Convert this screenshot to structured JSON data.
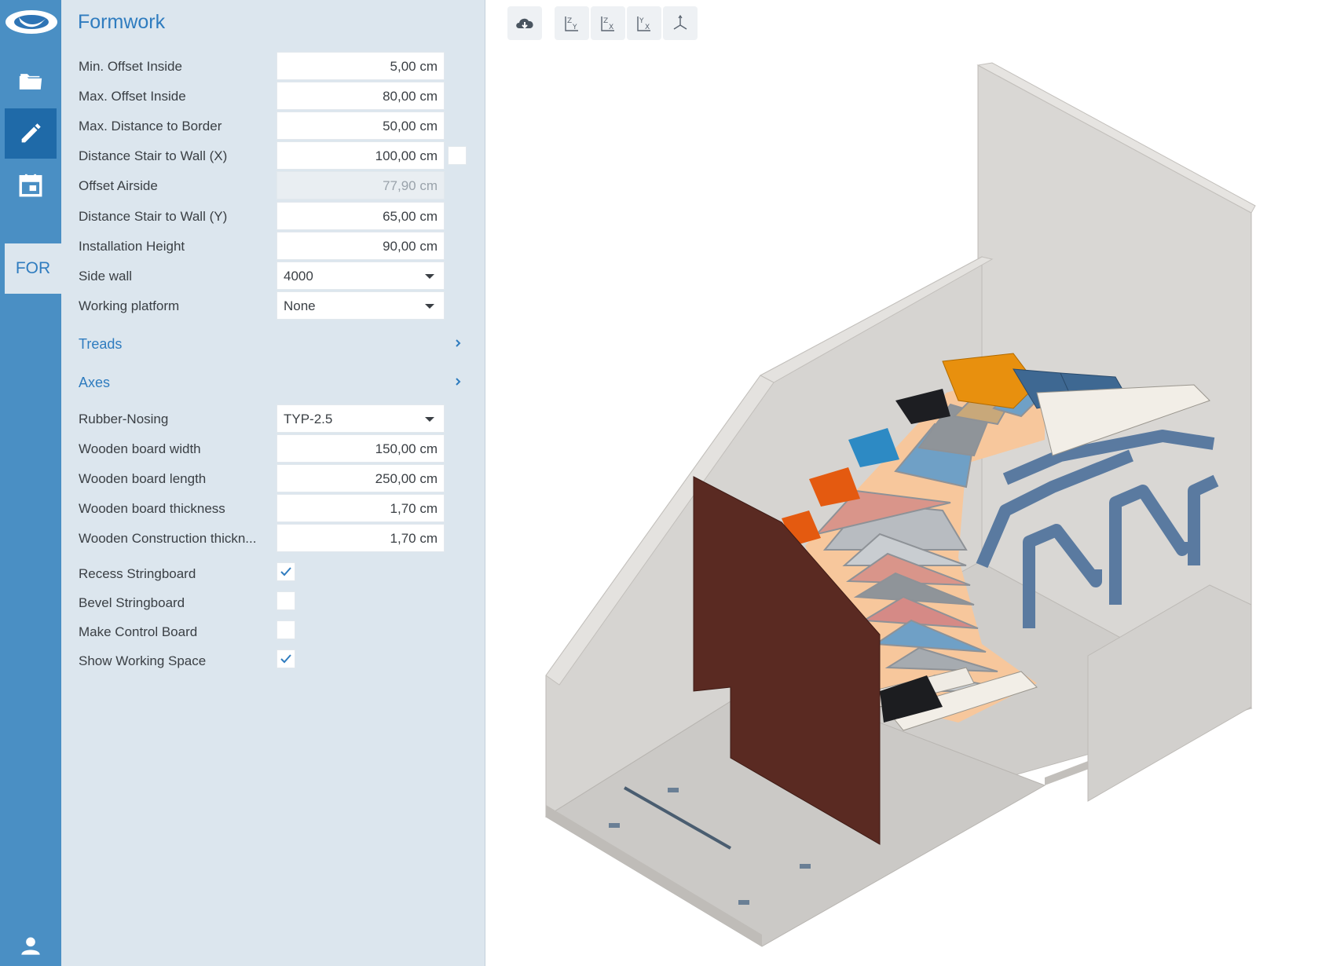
{
  "sidebar": {
    "module_label": "FOR",
    "items": [
      {
        "icon": "folder-icon"
      },
      {
        "icon": "pencil-icon",
        "active": true
      },
      {
        "icon": "calendar-icon"
      }
    ],
    "user_icon": "user-icon"
  },
  "panel": {
    "title": "Formwork",
    "fields_top": [
      {
        "label": "Min. Offset Inside",
        "value": "5,00 cm"
      },
      {
        "label": "Max. Offset Inside",
        "value": "80,00 cm"
      },
      {
        "label": "Max. Distance to Border",
        "value": "50,00 cm"
      },
      {
        "label": "Distance Stair to Wall (X)",
        "value": "100,00 cm"
      },
      {
        "label": "Offset Airside",
        "value": "77,90 cm",
        "disabled": true
      },
      {
        "label": "Distance Stair to Wall (Y)",
        "value": "65,00 cm"
      },
      {
        "label": "Installation Height",
        "value": "90,00 cm"
      }
    ],
    "side_wall": {
      "label": "Side wall",
      "value": "4000"
    },
    "working_platform": {
      "label": "Working platform",
      "value": "None"
    },
    "sections": [
      {
        "title": "Treads"
      },
      {
        "title": "Axes"
      }
    ],
    "rubber_nosing": {
      "label": "Rubber-Nosing",
      "value": "TYP-2.5"
    },
    "fields_bottom": [
      {
        "label": "Wooden board width",
        "value": "150,00 cm"
      },
      {
        "label": "Wooden board length",
        "value": "250,00 cm"
      },
      {
        "label": "Wooden board thickness",
        "value": "1,70 cm"
      },
      {
        "label": "Wooden Construction thickn...",
        "value": "1,70 cm"
      }
    ],
    "checkboxes": [
      {
        "label": "Recess Stringboard",
        "checked": true
      },
      {
        "label": "Bevel Stringboard",
        "checked": false
      },
      {
        "label": "Make Control Board",
        "checked": false
      },
      {
        "label": "Show Working Space",
        "checked": true
      }
    ]
  },
  "toolbar": {
    "buttons": [
      {
        "icon": "cloud-download-icon"
      },
      {
        "icon": "view-zy-icon",
        "label": "ZY"
      },
      {
        "icon": "view-zx-icon",
        "label": "ZX"
      },
      {
        "icon": "view-yx-icon",
        "label": "YX"
      },
      {
        "icon": "view-3d-axes-icon"
      }
    ]
  },
  "colors": {
    "rail": "#4a8fc4",
    "rail_active": "#1f6aa8",
    "panel_bg": "#dce6ee",
    "accent": "#2f7cbf",
    "wall": "#d6d4d1",
    "board_brown": "#5a2a22",
    "formwork_blue": "#5a7aa0",
    "stringer_peach": "#f7c79c"
  }
}
